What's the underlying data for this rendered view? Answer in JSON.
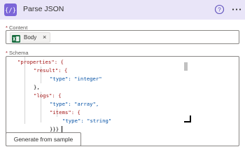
{
  "header": {
    "title": "Parse JSON",
    "icon": "braces-icon",
    "accent": "#7b65d8",
    "background": "#e9e5f8"
  },
  "content": {
    "label": "Content",
    "required_mark": "*",
    "token": {
      "label": "Body",
      "remove": "×",
      "icon": "excel-icon"
    }
  },
  "schema": {
    "label": "Schema",
    "required_mark": "*",
    "lines": [
      "\"properties\": {",
      "\"result\": {",
      "\"type\": \"integer\"",
      "},",
      "\"logs\": {",
      "\"type\": \"array\",",
      "\"items\": {",
      "\"type\": \"string\"",
      "}}}",
      "}"
    ]
  },
  "actions": {
    "generate_label": "Generate from sample"
  }
}
